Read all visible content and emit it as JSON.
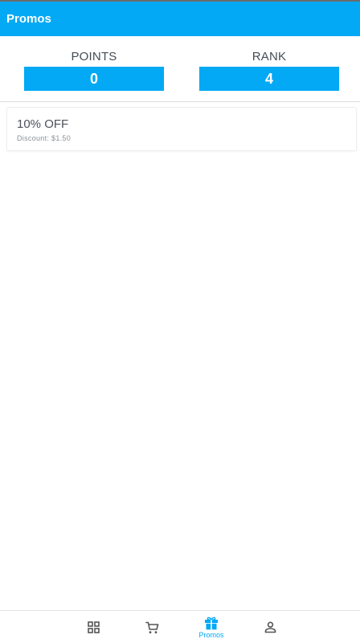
{
  "header": {
    "title": "Promos"
  },
  "stats": {
    "points": {
      "label": "POINTS",
      "value": "0"
    },
    "rank": {
      "label": "RANK",
      "value": "4"
    }
  },
  "promos": [
    {
      "title": "10% OFF",
      "subtitle": "Discount: $1.50"
    }
  ],
  "bottom_nav": {
    "items": [
      {
        "icon": "dashboard-icon",
        "label": ""
      },
      {
        "icon": "cart-icon",
        "label": ""
      },
      {
        "icon": "gift-icon",
        "label": "Promos",
        "active": true
      },
      {
        "icon": "person-icon",
        "label": ""
      }
    ]
  },
  "colors": {
    "primary": "#03a9f4",
    "inactive_icon": "#555555"
  }
}
